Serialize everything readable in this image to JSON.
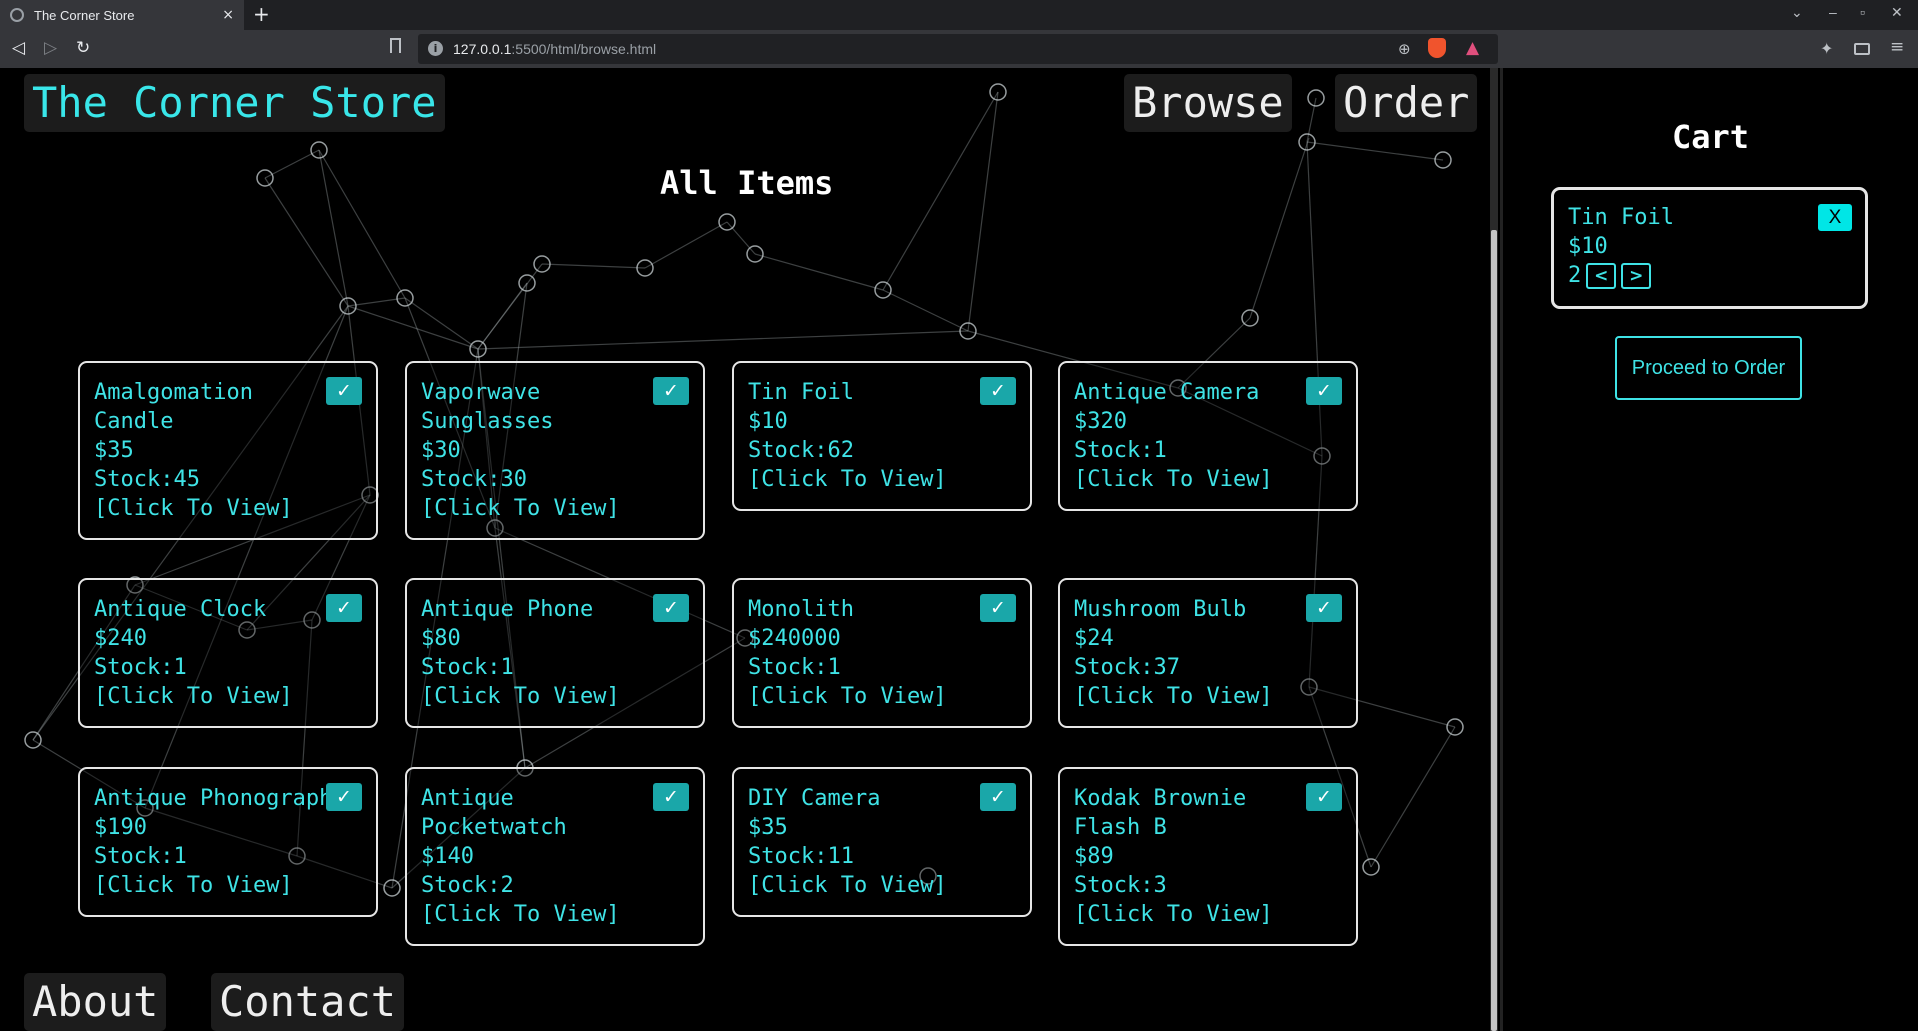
{
  "browser": {
    "tab_title": "The Corner Store",
    "tab_close": "×",
    "new_tab": "+",
    "url_host": "127.0.0.1",
    "url_rest": ":5500/html/browse.html",
    "window_controls": [
      "⌄",
      "–",
      "▫",
      "✕"
    ]
  },
  "header": {
    "brand": "The Corner Store",
    "nav": [
      {
        "label": "Browse"
      },
      {
        "label": "Order"
      }
    ]
  },
  "main": {
    "title": "All Items",
    "check_mark": "✓",
    "items": [
      {
        "name": "Amalgomation Candle",
        "price": "$35",
        "stock": "Stock:45",
        "view": "[Click To View]"
      },
      {
        "name": "Vaporwave Sunglasses",
        "price": "$30",
        "stock": "Stock:30",
        "view": "[Click To View]"
      },
      {
        "name": "Tin Foil",
        "price": "$10",
        "stock": "Stock:62",
        "view": "[Click To View]"
      },
      {
        "name": "Antique Camera",
        "price": "$320",
        "stock": "Stock:1",
        "view": "[Click To View]"
      },
      {
        "name": "Antique Clock",
        "price": "$240",
        "stock": "Stock:1",
        "view": "[Click To View]"
      },
      {
        "name": "Antique Phone",
        "price": "$80",
        "stock": "Stock:1",
        "view": "[Click To View]"
      },
      {
        "name": "Monolith",
        "price": "$240000",
        "stock": "Stock:1",
        "view": "[Click To View]"
      },
      {
        "name": "Mushroom Bulb",
        "price": "$24",
        "stock": "Stock:37",
        "view": "[Click To View]"
      },
      {
        "name": "Antique Phonograph",
        "price": "$190",
        "stock": "Stock:1",
        "view": "[Click To View]"
      },
      {
        "name": "Antique Pocketwatch",
        "price": "$140",
        "stock": "Stock:2",
        "view": "[Click To View]"
      },
      {
        "name": "DIY Camera",
        "price": "$35",
        "stock": "Stock:11",
        "view": "[Click To View]"
      },
      {
        "name": "Kodak Brownie Flash B",
        "price": "$89",
        "stock": "Stock:3",
        "view": "[Click To View]"
      }
    ]
  },
  "footer": {
    "links": [
      {
        "label": "About"
      },
      {
        "label": "Contact"
      }
    ]
  },
  "cart": {
    "title": "Cart",
    "items": [
      {
        "name": "Tin Foil",
        "price": "$10",
        "qty": "2",
        "remove": "X",
        "dec": "<",
        "inc": ">"
      }
    ],
    "proceed_label": "Proceed to Order"
  },
  "colors": {
    "accent": "#3fe3e6",
    "check_bg": "#1aa7a9",
    "remove_bg": "#00e6e6",
    "card_border": "#e6e6e6",
    "background": "#000000"
  }
}
